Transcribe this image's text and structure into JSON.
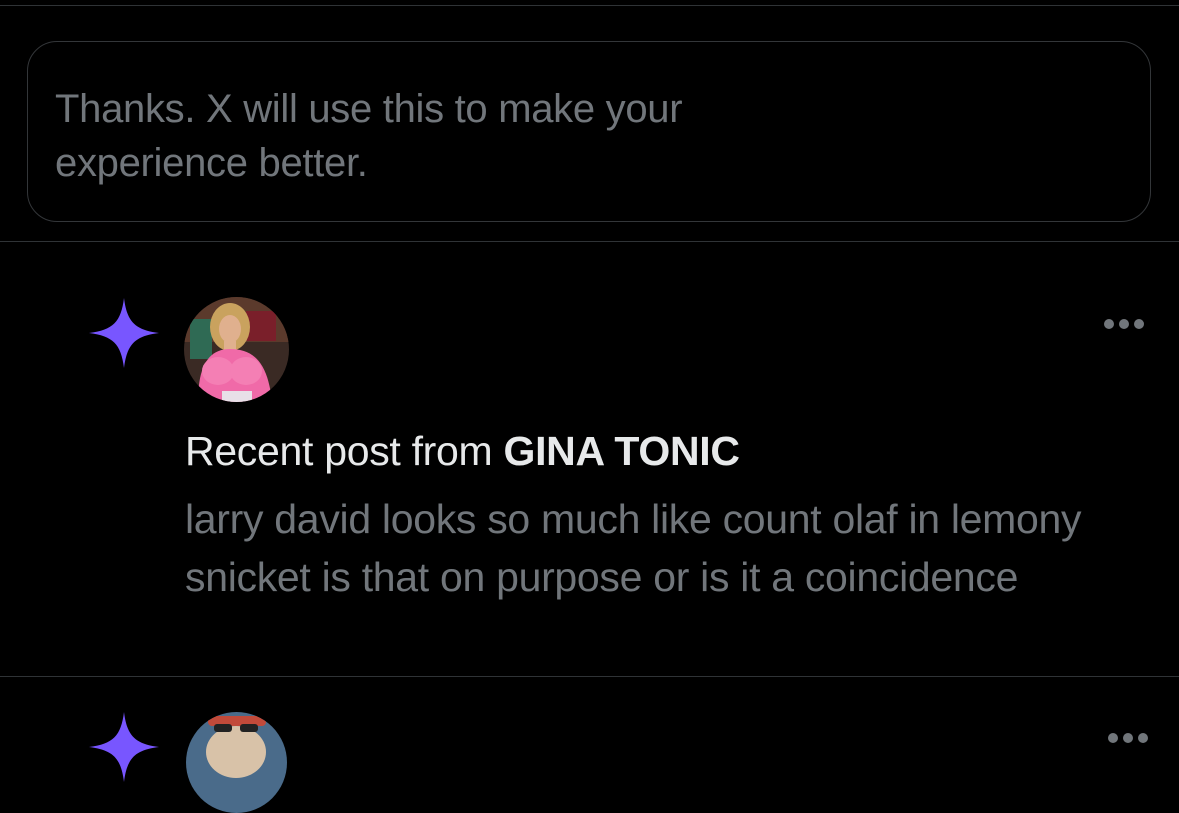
{
  "feedback": {
    "message": "Thanks. X will use this to make your experience better."
  },
  "notifications": [
    {
      "icon": "sparkle-icon",
      "avatar": "avatar-gina-tonic",
      "heading_prefix": "Recent post from ",
      "author": "GINA TONIC",
      "body": "larry david looks so much like count olaf in lemony snicket is that on purpose or is it a coincidence"
    },
    {
      "icon": "sparkle-icon",
      "avatar": "avatar-next"
    }
  ],
  "colors": {
    "background": "#000000",
    "accent_star": "#7856ff",
    "primary_text": "#e7e9ea",
    "secondary_text": "#71767b",
    "divider": "#2f3336"
  }
}
